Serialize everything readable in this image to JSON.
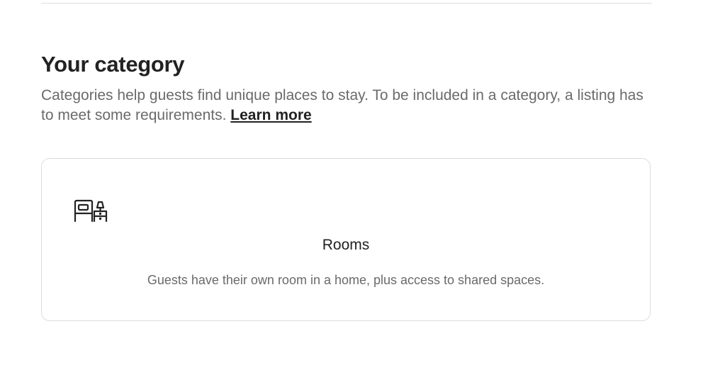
{
  "section": {
    "title": "Your category",
    "description": "Categories help guests find unique places to stay. To be included in a category, a listing has to meet some requirements.",
    "learn_more_label": "Learn more"
  },
  "category_card": {
    "icon": "bed-with-nightstand-icon",
    "title": "Rooms",
    "description": "Guests have their own room in a home, plus access to shared spaces."
  },
  "colors": {
    "text_primary": "#222222",
    "text_secondary": "#6a6a6a",
    "border": "#dddddd"
  }
}
